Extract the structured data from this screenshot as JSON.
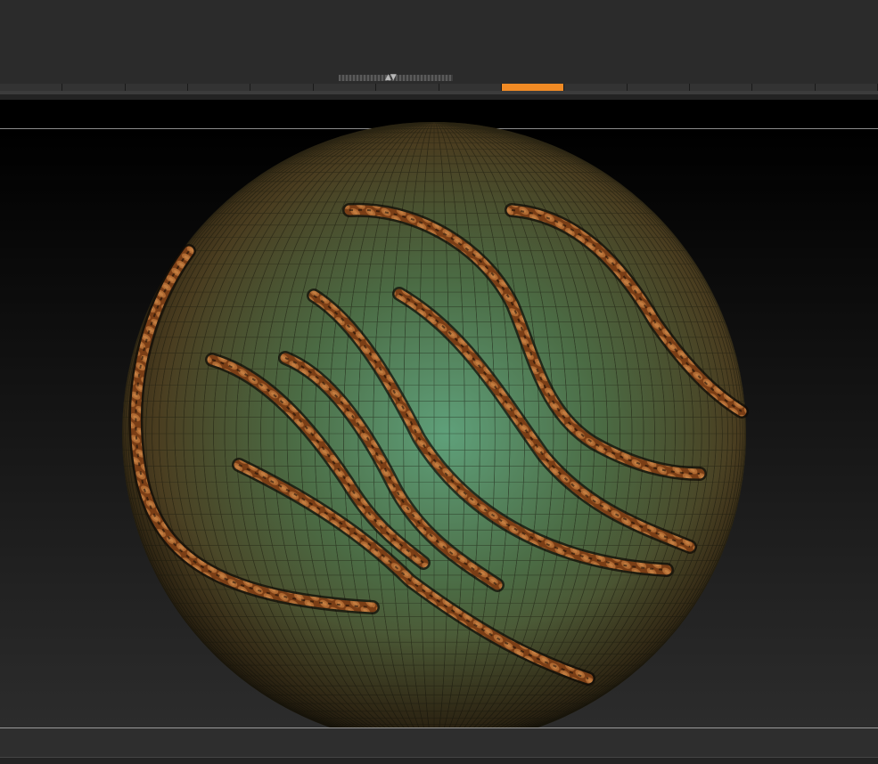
{
  "colors": {
    "active_tab": "#f08a24",
    "sphere_light": "#5fa07a",
    "sphere_mid": "#4a5a36",
    "sphere_dark": "#2a1a0a",
    "rope": "#8a4a1c"
  },
  "icons": {
    "collapse_handle": "collapse-arrows-icon"
  },
  "tabs": [
    {
      "active": false
    },
    {
      "active": false
    },
    {
      "active": false
    },
    {
      "active": false
    },
    {
      "active": false
    },
    {
      "active": false
    },
    {
      "active": false
    },
    {
      "active": false
    },
    {
      "active": true
    },
    {
      "active": false
    },
    {
      "active": false
    },
    {
      "active": false
    },
    {
      "active": false
    },
    {
      "active": false
    }
  ]
}
